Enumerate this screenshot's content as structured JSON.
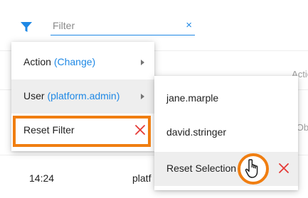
{
  "filter": {
    "placeholder": "Filter",
    "clear_icon": "×"
  },
  "grid": {
    "column_header_partial": "Actio",
    "cell_partial": "Obl",
    "row": {
      "time": "14:24",
      "user_partial": "platf"
    }
  },
  "menu": {
    "items": [
      {
        "label": "Action",
        "detail": "(Change)"
      },
      {
        "label": "User",
        "detail": "(platform.admin)"
      },
      {
        "label": "Reset Filter"
      }
    ]
  },
  "submenu": {
    "items": [
      {
        "label": "jane.marple"
      },
      {
        "label": "david.stringer"
      },
      {
        "label": "Reset Selection"
      }
    ]
  },
  "colors": {
    "accent": "#1e88e5",
    "highlight": "#f07e11",
    "danger": "#e53935"
  }
}
